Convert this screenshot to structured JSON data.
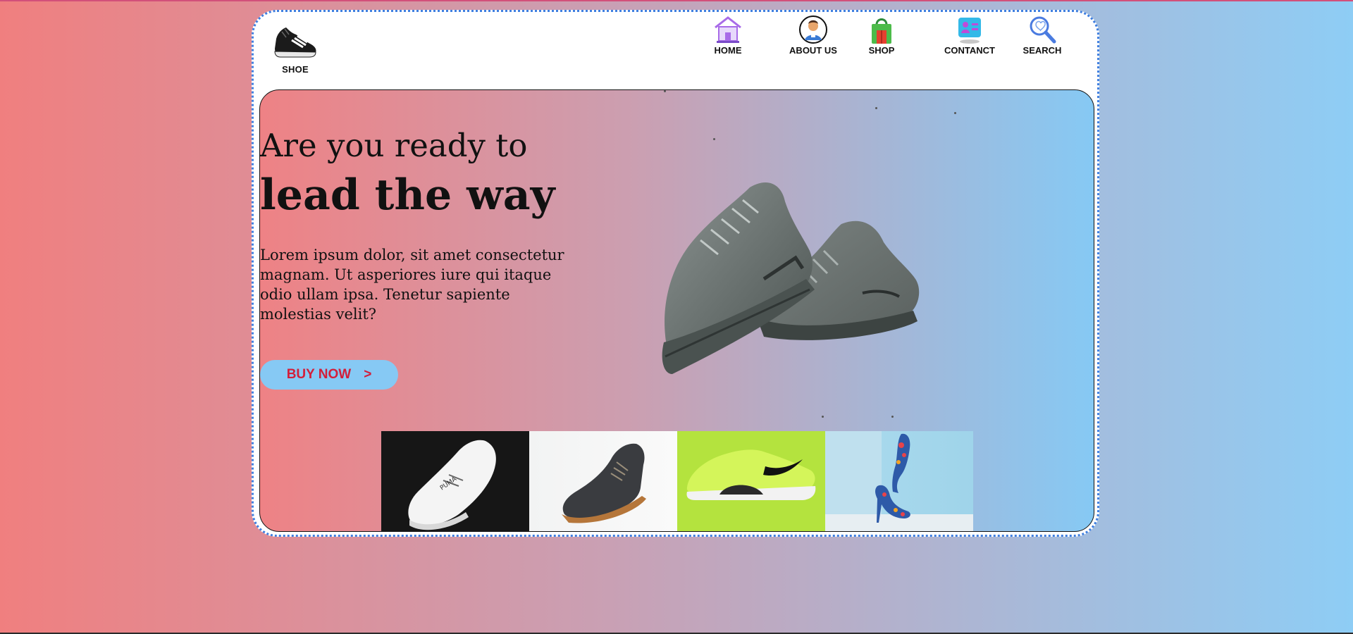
{
  "brand": {
    "logo_label": "SHOE"
  },
  "nav": {
    "items": [
      {
        "label": "HOME",
        "icon": "home-icon"
      },
      {
        "label": "ABOUT US",
        "icon": "person-icon"
      },
      {
        "label": "SHOP",
        "icon": "shopping-bag-icon"
      },
      {
        "label": "CONTANCT",
        "icon": "contact-card-icon"
      },
      {
        "label": "SEARCH",
        "icon": "search-icon"
      }
    ]
  },
  "hero": {
    "line1": "Are you ready to",
    "line2": "lead the way",
    "paragraph": "Lorem ipsum dolor, sit amet consectetur magnam. Ut asperiores iure qui itaque odio ullam ipsa. Tenetur sapiente molestias velit?",
    "buy_label": "BUY NOW",
    "buy_arrow": ">"
  },
  "thumbnails": [
    {
      "name": "white-sneaker",
      "bg": "#161616"
    },
    {
      "name": "grey-boot",
      "bg": "#f4f4f4"
    },
    {
      "name": "neon-sneaker",
      "bg": "#b4e33e"
    },
    {
      "name": "floral-heels",
      "bg": "#a7d8ec"
    }
  ],
  "colors": {
    "accent_button": "#86c9f4",
    "button_text": "#d31e3a",
    "card_border": "#3f7fe0"
  }
}
